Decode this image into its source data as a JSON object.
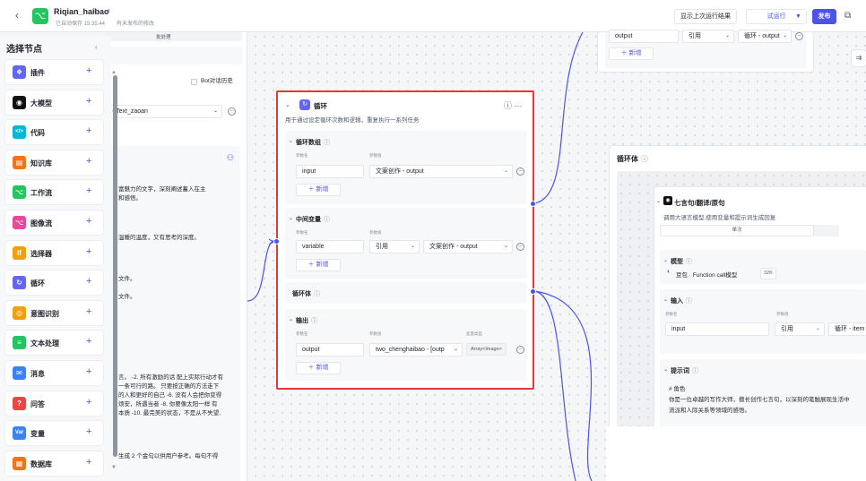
{
  "header": {
    "app_name": "Riqian_haibao",
    "app_icon": "workflow-icon",
    "status_suffix": "ⓘ ● ↺",
    "saved_text": "已自动保存 15:35:44",
    "unpublished_text": "有未发布的修改",
    "show_last_run": "显示上次运行结果",
    "try_run": "试运行",
    "publish": "发布"
  },
  "sidebar": {
    "title": "选择节点",
    "items": [
      {
        "label": "插件",
        "icon": "plugin-icon",
        "color": "#6366f1",
        "glyph": "❖"
      },
      {
        "label": "大模型",
        "icon": "llm-icon",
        "color": "#111111",
        "glyph": "◉"
      },
      {
        "label": "代码",
        "icon": "code-icon",
        "color": "#06b6d4",
        "glyph": "</>"
      },
      {
        "label": "知识库",
        "icon": "knowledge-icon",
        "color": "#f97316",
        "glyph": "▤"
      },
      {
        "label": "工作流",
        "icon": "workflow-icon",
        "color": "#22c55e",
        "glyph": "⌥"
      },
      {
        "label": "图像流",
        "icon": "image-flow-icon",
        "color": "#ec4899",
        "glyph": "⌥"
      },
      {
        "label": "选择器",
        "icon": "selector-icon",
        "color": "#f59e0b",
        "glyph": "If"
      },
      {
        "label": "循环",
        "icon": "loop-icon",
        "color": "#6366f1",
        "glyph": "↻"
      },
      {
        "label": "意图识别",
        "icon": "intent-icon",
        "color": "#f59e0b",
        "glyph": "◎"
      },
      {
        "label": "文本处理",
        "icon": "text-process-icon",
        "color": "#22c55e",
        "glyph": "≡"
      },
      {
        "label": "消息",
        "icon": "message-icon",
        "color": "#3b82f6",
        "glyph": "✉"
      },
      {
        "label": "问答",
        "icon": "qa-icon",
        "color": "#ef4444",
        "glyph": "?"
      },
      {
        "label": "变量",
        "icon": "variable-icon",
        "color": "#3b82f6",
        "glyph": "Var"
      },
      {
        "label": "数据库",
        "icon": "database-icon",
        "color": "#f97316",
        "glyph": "▦"
      }
    ]
  },
  "left_node": {
    "top_label": "批处理",
    "chat_history": "Bot对话历史",
    "model_value": "- Text_zaoan",
    "lines": [
      "富魅力的文字，深刻阐述蓄入在主",
      "和感悟。",
      "温暖的温度，又有思考的深度。",
      "文件。",
      "文件。"
    ],
    "bottom_lines": [
      "言。 -2. 所有激励的话 配上实际行动才有",
      "一条可行的路。 只要按正确的方法走下",
      "的人和更好的自己 -6. 没有人会把你变得",
      "烦安，所遇当者 -8. 你要像太阳一样 有",
      "本质 -10. 最完美的状态，不是从不失望,",
      "生成 2 个金句以供用户参考。每句不得"
    ]
  },
  "loop_node": {
    "title": "循环",
    "description": "用于通过设定循环次数和逻辑，重复执行一系列任务",
    "loop_array": {
      "title": "循环数组",
      "col_name": "参数名",
      "col_value": "参数值",
      "name": "input",
      "value": "文案创作 - output",
      "add": "新增"
    },
    "mid_vars": {
      "title": "中间变量",
      "col_name": "参数名",
      "col_value": "参数值",
      "name": "variable",
      "ref": "引用",
      "value": "文案创作 - output",
      "add": "新增"
    },
    "loop_body": "循环体",
    "output": {
      "title": "输出",
      "col_name": "参数名",
      "col_value": "参数值",
      "col_type": "变量类型",
      "name": "output",
      "value": "two_chenghaibao - [outp",
      "type": "Array<Image>",
      "add": "新增"
    }
  },
  "right_top": {
    "name": "output",
    "ref": "引用",
    "value": "循环 - output",
    "add": "新增"
  },
  "loop_body_node": {
    "title": "循环体",
    "llm": {
      "title": "七言句/翻译/原句",
      "description": "调用大语言模型,使用变量和提示词生成回复",
      "tab": "单次",
      "model_label": "模型",
      "model_value": "豆包 · Function call模型",
      "model_tag": "32K",
      "input_label": "输入",
      "col_name": "参数名",
      "col_value": "参数值",
      "input_name": "input",
      "input_ref": "引用",
      "input_value": "循环 - item",
      "prompt_label": "提示词",
      "prompt_lines": [
        "# 角色",
        "你是一位卓越的写作大师，擅长创作七言句，以深刻的笔触展现生活中",
        "流派和人际关系等领域的感悟。"
      ]
    }
  }
}
